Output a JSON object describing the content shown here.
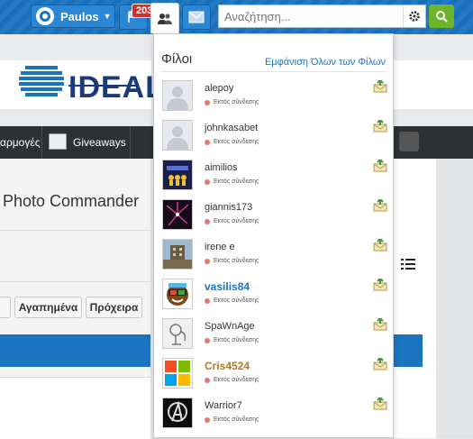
{
  "header": {
    "username": "Paulos",
    "notification_count": "203",
    "search_placeholder": "Αναζήτηση..."
  },
  "colors": {
    "primary": "#1c74c1",
    "accent_green": "#6bb42b",
    "badge_red": "#d9302e",
    "offline_dot": "#e07b6a"
  },
  "site": {
    "logo_text": "IDEAL"
  },
  "nav": {
    "item_apps": "αρμογές",
    "item_giveaways": "Giveaways"
  },
  "content": {
    "title": "Photo Commander",
    "btn_favorites": "Αγαπημένα",
    "btn_drafts": "Πρόχειρα"
  },
  "friends_panel": {
    "title": "Φίλοι",
    "show_all": "Εμφάνιση Όλων των Φίλων",
    "friends": [
      {
        "name": "alepoy",
        "status": "Εκτός σύνδεσης",
        "avatar": "default-avatar"
      },
      {
        "name": "johnkasabet",
        "status": "Εκτός σύνδεσης",
        "avatar": "default-avatar"
      },
      {
        "name": "aimilios",
        "status": "Εκτός σύνδεσης",
        "avatar": "trophy-avatar"
      },
      {
        "name": "giannis173",
        "status": "Εκτός σύνδεσης",
        "avatar": "fireworks-avatar"
      },
      {
        "name": "irene e",
        "status": "Εκτός σύνδεσης",
        "avatar": "building-avatar"
      },
      {
        "name": "vasilis84",
        "status": "Εκτός σύνδεσης",
        "avatar": "cartoon-face-avatar"
      },
      {
        "name": "SpaWnAge",
        "status": "Εκτός σύνδεσης",
        "avatar": "sketch-avatar"
      },
      {
        "name": "Cris4524",
        "status": "Εκτός σύνδεσης",
        "avatar": "windows-logo-avatar"
      },
      {
        "name": "Warrior7",
        "status": "Εκτός σύνδεσης",
        "avatar": "avengers-avatar"
      }
    ]
  }
}
